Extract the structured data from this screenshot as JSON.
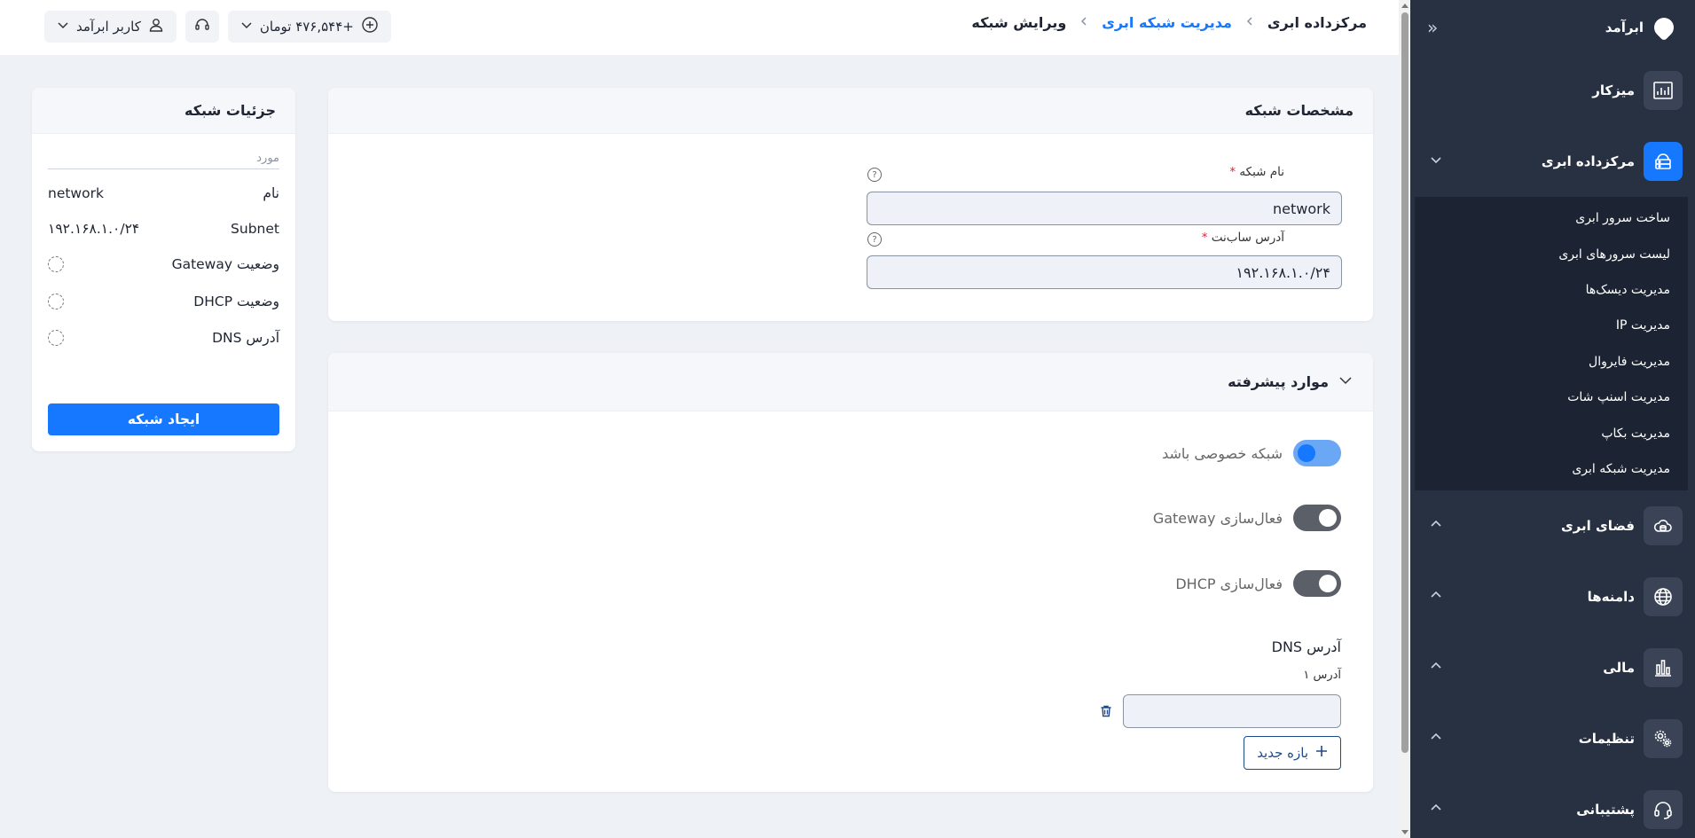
{
  "sidebar": {
    "brand": "ابرآمد",
    "items": {
      "dashboard": {
        "label": "میزکار",
        "icon": "chart-icon"
      },
      "datacenter": {
        "label": "مرکزداده ابری",
        "icon": "server-icon"
      },
      "cloud_space": {
        "label": "فضای ابری",
        "icon": "cloud-icon"
      },
      "domains": {
        "label": "دامنه‌ها",
        "icon": "globe-icon"
      },
      "finance": {
        "label": "مالی",
        "icon": "bar-chart-icon"
      },
      "settings": {
        "label": "تنظیمات",
        "icon": "gear-icon"
      },
      "support": {
        "label": "پشتیبانی",
        "icon": "headset-icon"
      }
    },
    "submenu": [
      "ساخت سرور ابری",
      "لیست سرورهای ابری",
      "مدیریت دیسک‌ها",
      "مدیریت IP",
      "مدیریت فایروال",
      "مدیریت اسنپ شات",
      "مدیریت بکاپ",
      "مدیریت شبکه ابری"
    ]
  },
  "header": {
    "breadcrumb": [
      "مرکزداده ابری",
      "مدیریت شبکه ابری",
      "ویرایش شبکه"
    ],
    "balance": "+۴۷۶,۵۴۴ تومان",
    "user": "کاربر ابرآمد"
  },
  "network_specs": {
    "title": "مشخصات شبکه",
    "name_label": "نام شبکه",
    "name_value": "network",
    "subnet_label": "آدرس ساب‌نت",
    "subnet_value": "۱۹۲.۱۶۸.۱.۰/۲۴"
  },
  "advanced": {
    "title": "موارد پیشرفته",
    "private_label": "شبکه خصوصی باشد",
    "private_on": true,
    "gateway_label": "فعال‌سازی Gateway",
    "gateway_on": false,
    "dhcp_label": "فعال‌سازی DHCP",
    "dhcp_on": false,
    "dns_title": "آدرس DNS",
    "dns_addr_label": "آدرس ۱",
    "dns_addr_value": "",
    "add_range_label": "بازه جدید"
  },
  "details": {
    "title": "جزئیات شبکه",
    "col_header": "مورد",
    "rows": [
      {
        "key": "نام",
        "value": "network"
      },
      {
        "key": "Subnet",
        "value": "۱۹۲.۱۶۸.۱.۰/۲۴"
      },
      {
        "key": "وضعیت Gateway",
        "value": ""
      },
      {
        "key": "وضعیت DHCP",
        "value": ""
      },
      {
        "key": "آدرس DNS",
        "value": ""
      }
    ],
    "create_label": "ایجاد شبکه"
  },
  "colors": {
    "accent": "#1677ff",
    "sidebar_bg": "#283142",
    "submenu_bg": "#1c2433"
  }
}
